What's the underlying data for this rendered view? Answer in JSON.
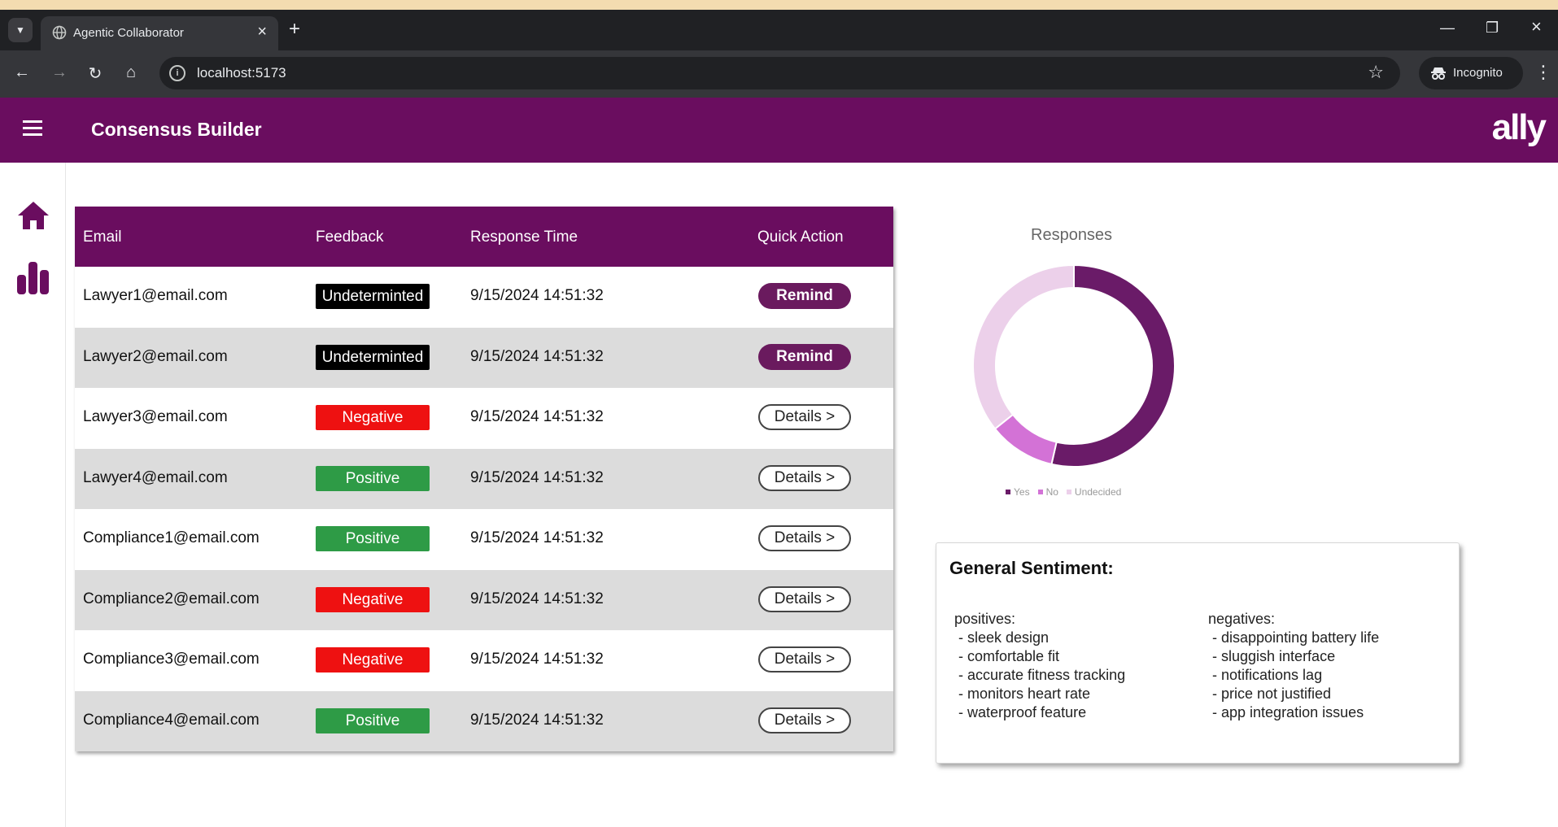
{
  "browser": {
    "tab_title": "Agentic Collaborator",
    "url": "localhost:5173",
    "incognito_label": "Incognito"
  },
  "app": {
    "title": "Consensus Builder",
    "logo": "ally",
    "brand_color": "#6a0d5f"
  },
  "sidebar": {
    "items": [
      {
        "icon": "home-icon"
      },
      {
        "icon": "bar-chart-icon"
      }
    ]
  },
  "table": {
    "headers": [
      "Email",
      "Feedback",
      "Response Time",
      "Quick Action"
    ],
    "rows": [
      {
        "email": "Lawyer1@email.com",
        "feedback": "Undeterminted",
        "time": "9/15/2024 14:51:32",
        "action": "Remind"
      },
      {
        "email": "Lawyer2@email.com",
        "feedback": "Undeterminted",
        "time": "9/15/2024 14:51:32",
        "action": "Remind"
      },
      {
        "email": "Lawyer3@email.com",
        "feedback": "Negative",
        "time": "9/15/2024 14:51:32",
        "action": "Details >"
      },
      {
        "email": "Lawyer4@email.com",
        "feedback": "Positive",
        "time": "9/15/2024 14:51:32",
        "action": "Details >"
      },
      {
        "email": "Compliance1@email.com",
        "feedback": "Positive",
        "time": "9/15/2024 14:51:32",
        "action": "Details >"
      },
      {
        "email": "Compliance2@email.com",
        "feedback": "Negative",
        "time": "9/15/2024 14:51:32",
        "action": "Details >"
      },
      {
        "email": "Compliance3@email.com",
        "feedback": "Negative",
        "time": "9/15/2024 14:51:32",
        "action": "Details >"
      },
      {
        "email": "Compliance4@email.com",
        "feedback": "Positive",
        "time": "9/15/2024 14:51:32",
        "action": "Details >"
      }
    ],
    "status_colors": {
      "Undeterminted": "#000000",
      "Negative": "#ee1111",
      "Positive": "#2e9b46"
    }
  },
  "chart_data": {
    "type": "pie",
    "title": "Responses",
    "categories": [
      "Yes",
      "No",
      "Undecided"
    ],
    "values": [
      3,
      0.6,
      2
    ],
    "colors": [
      "#6a1b68",
      "#d372d6",
      "#ecd0ea"
    ],
    "legend": "bottom"
  },
  "sentiment": {
    "title": "General Sentiment:",
    "positives_label": "positives:",
    "positives": [
      "sleek design",
      "comfortable fit",
      "accurate fitness tracking",
      "monitors heart rate",
      "waterproof feature"
    ],
    "negatives_label": "negatives:",
    "negatives": [
      "disappointing battery life",
      "sluggish interface",
      "notifications lag",
      "price not justified",
      "app integration issues"
    ]
  }
}
